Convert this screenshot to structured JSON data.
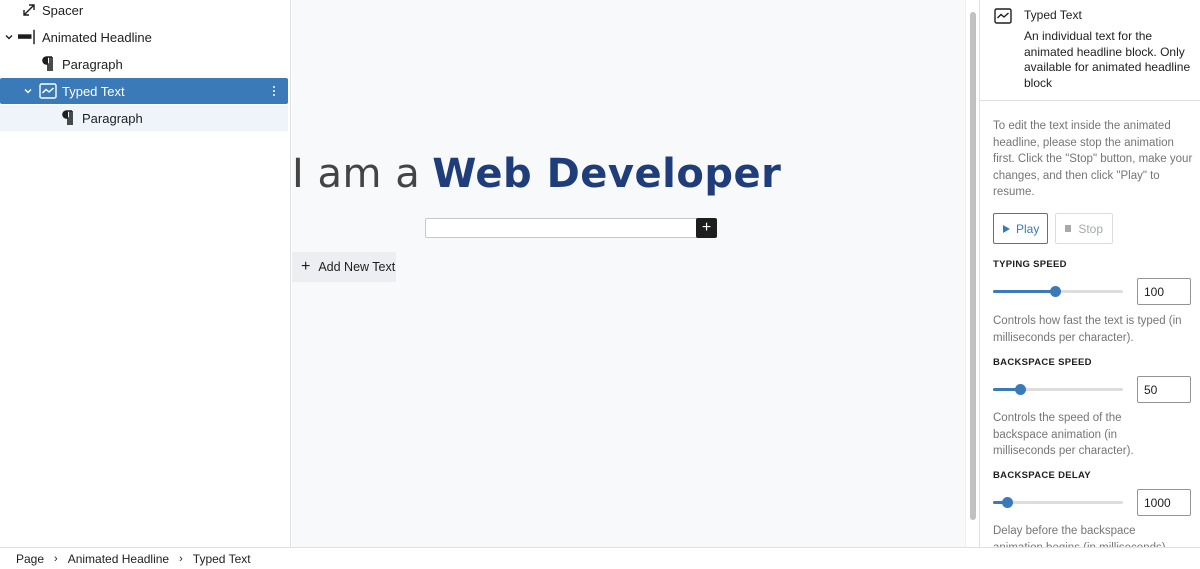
{
  "list_view": {
    "items": [
      {
        "label": "Spacer",
        "icon": "resize-icon"
      },
      {
        "label": "Animated Headline",
        "icon": "headline-icon"
      },
      {
        "label": "Paragraph",
        "icon": "paragraph-icon"
      },
      {
        "label": "Typed Text",
        "icon": "typed-text-icon"
      },
      {
        "label": "Paragraph",
        "icon": "paragraph-icon"
      }
    ]
  },
  "canvas": {
    "headline_static": "I am a",
    "headline_typed": "Web Developer",
    "add_new_text": "Add New Text",
    "inserter_symbol": "+"
  },
  "sidebar": {
    "block_title": "Typed Text",
    "block_description": "An individual text for the animated headline block. Only available for animated headline block",
    "edit_help": "To edit the text inside the animated headline, please stop the animation first. Click the \"Stop\" button, make your changes, and then click \"Play\" to resume.",
    "play_label": "Play",
    "stop_label": "Stop",
    "typing_speed": {
      "label": "TYPING SPEED",
      "value": "100",
      "slider_fraction": 0.48,
      "help": "Controls how fast the text is typed (in milliseconds per character)."
    },
    "backspace_speed": {
      "label": "BACKSPACE SPEED",
      "value": "50",
      "slider_fraction": 0.21,
      "help": "Controls the speed of the backspace animation (in milliseconds per character)."
    },
    "backspace_delay": {
      "label": "BACKSPACE DELAY",
      "value": "1000",
      "slider_fraction": 0.11,
      "help": "Delay before the backspace animation begins (in milliseconds)."
    }
  },
  "breadcrumb": {
    "items": [
      "Page",
      "Animated Headline",
      "Typed Text"
    ],
    "separator": "›"
  },
  "colors": {
    "accent": "#3a7ab8",
    "headline_typed": "#1f3d7a"
  }
}
